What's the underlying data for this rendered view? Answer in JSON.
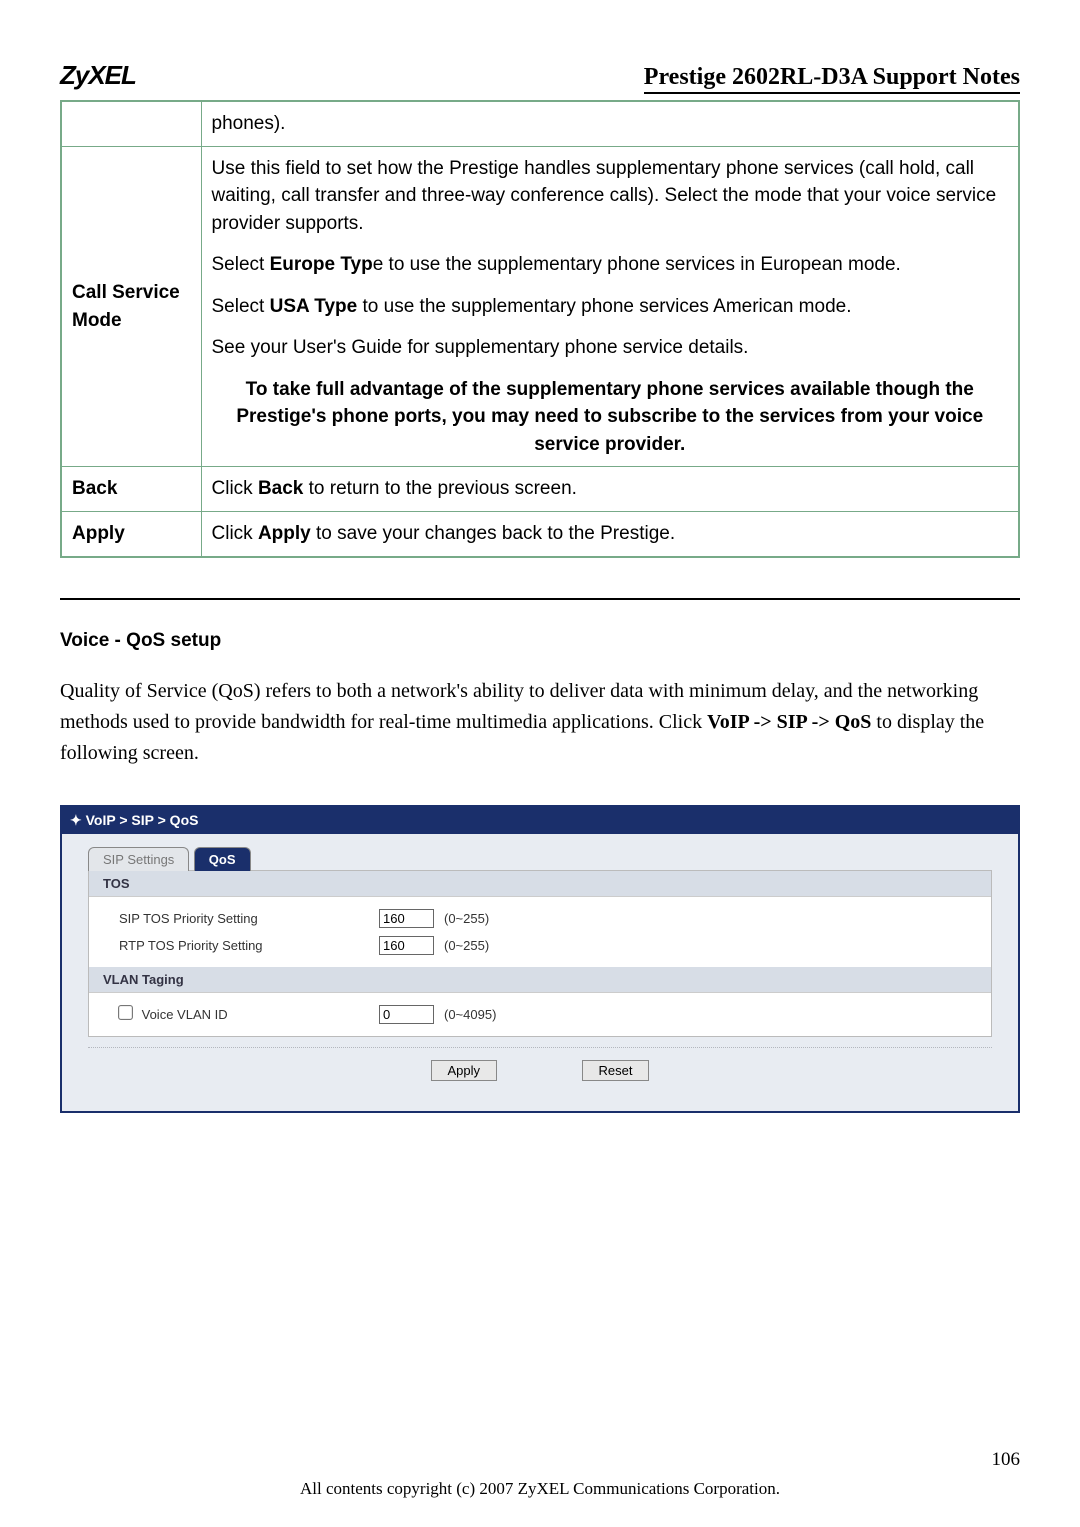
{
  "header": {
    "logo": "ZyXEL",
    "doc_title": "Prestige 2602RL-D3A Support Notes"
  },
  "table": {
    "r0": {
      "c1": "phones)."
    },
    "r1": {
      "label": "Call Service Mode",
      "p1": "Use this field to set how the Prestige handles supplementary phone services (call hold, call waiting, call transfer and three-way conference calls). Select the mode that your voice service provider supports.",
      "p2a": "Select ",
      "p2b": "Europe Typ",
      "p2c": "e to use the supplementary phone services in European mode.",
      "p3a": "Select ",
      "p3b": "USA Type",
      "p3c": " to use the supplementary phone services American mode.",
      "p4": "See your User's Guide for supplementary phone service details.",
      "p5": "To take full advantage of the supplementary phone services available though the Prestige's phone ports, you may need to subscribe to the services from your voice service provider."
    },
    "r2": {
      "label": "Back",
      "t1": "Click ",
      "t2": "Back",
      "t3": " to return to the previous screen."
    },
    "r3": {
      "label": "Apply",
      "t1": "Click ",
      "t2": "Apply",
      "t3": " to save your changes back to the Prestige."
    }
  },
  "section": {
    "heading": "Voice - QoS setup",
    "para_a": "Quality of Service (QoS) refers to both a network's ability to deliver data with minimum delay, and the networking methods used to provide bandwidth for real-time multimedia applications. Click ",
    "para_b": "VoIP -> SIP -> QoS",
    "para_c": " to display the following screen."
  },
  "shot": {
    "crumb_pre": "✦ ",
    "crumb": "VoIP > SIP > QoS",
    "tabs": {
      "sip": "SIP Settings",
      "qos": "QoS"
    },
    "tos": {
      "bar": "TOS",
      "sip_label": "SIP TOS Priority Setting",
      "sip_val": "160",
      "sip_range": "(0~255)",
      "rtp_label": "RTP TOS Priority Setting",
      "rtp_val": "160",
      "rtp_range": "(0~255)"
    },
    "vlan": {
      "bar": "VLAN Taging",
      "label": "Voice VLAN ID",
      "val": "0",
      "range": "(0~4095)"
    },
    "buttons": {
      "apply": "Apply",
      "reset": "Reset"
    }
  },
  "footer": {
    "page": "106",
    "copyright": "All contents copyright (c) 2007 ZyXEL Communications Corporation."
  }
}
